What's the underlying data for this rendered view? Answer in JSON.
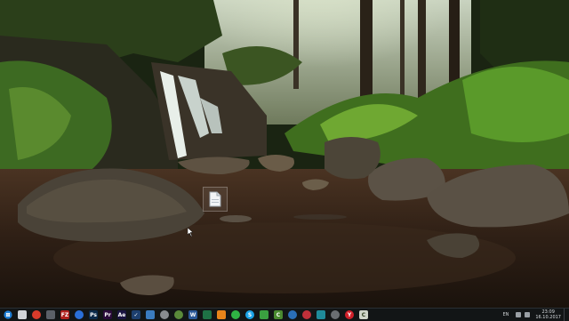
{
  "desktop": {
    "file_icon": "document-icon"
  },
  "taskbar": {
    "start_icon": "windows-icon",
    "pinned": [
      {
        "name": "taskbar-icon-explorer",
        "text": "",
        "bg": "#d0d4d8",
        "round": false
      },
      {
        "name": "taskbar-icon-chrome",
        "text": "",
        "bg": "#d83b2b",
        "round": true
      },
      {
        "name": "taskbar-icon-calculator",
        "text": "",
        "bg": "#5a6068",
        "round": false
      },
      {
        "name": "taskbar-icon-filezilla",
        "text": "FZ",
        "bg": "#b0201c",
        "round": false
      },
      {
        "name": "taskbar-icon-firefox",
        "text": "",
        "bg": "#2a6fd8",
        "round": true
      },
      {
        "name": "taskbar-icon-photoshop",
        "text": "Ps",
        "bg": "#0b2a4a",
        "round": false
      },
      {
        "name": "taskbar-icon-premiere",
        "text": "Pr",
        "bg": "#2a0b3a",
        "round": false
      },
      {
        "name": "taskbar-icon-after-effects",
        "text": "Ae",
        "bg": "#1a1440",
        "round": false
      },
      {
        "name": "taskbar-icon-tasks",
        "text": "✓",
        "bg": "#1d3f6e",
        "round": false
      },
      {
        "name": "taskbar-icon-steam",
        "text": "",
        "bg": "#3a7cc0",
        "round": false
      },
      {
        "name": "taskbar-icon-clock-app",
        "text": "",
        "bg": "#888c90",
        "round": true
      },
      {
        "name": "taskbar-icon-green-app",
        "text": "",
        "bg": "#5a8a3a",
        "round": true
      },
      {
        "name": "taskbar-icon-word",
        "text": "W",
        "bg": "#2b5797",
        "round": false
      },
      {
        "name": "taskbar-icon-excel",
        "text": "",
        "bg": "#1e7145",
        "round": false
      },
      {
        "name": "taskbar-icon-vlc",
        "text": "",
        "bg": "#e8841a",
        "round": false
      },
      {
        "name": "taskbar-icon-whatsapp",
        "text": "",
        "bg": "#2fb344",
        "round": true
      },
      {
        "name": "taskbar-icon-skype",
        "text": "S",
        "bg": "#1aa3e8",
        "round": true
      },
      {
        "name": "taskbar-icon-green-square",
        "text": "",
        "bg": "#3aa040",
        "round": false
      },
      {
        "name": "taskbar-icon-camtasia",
        "text": "C",
        "bg": "#4a8a30",
        "round": false
      },
      {
        "name": "taskbar-icon-search-app",
        "text": "",
        "bg": "#2a6fb8",
        "round": true
      },
      {
        "name": "taskbar-icon-opera",
        "text": "",
        "bg": "#c0303a",
        "round": true
      },
      {
        "name": "taskbar-icon-photos",
        "text": "",
        "bg": "#1f8a9a",
        "round": false
      },
      {
        "name": "taskbar-icon-settings",
        "text": "",
        "bg": "#6a6e72",
        "round": true
      },
      {
        "name": "taskbar-icon-yandex",
        "text": "Y",
        "bg": "#d0202a",
        "round": true
      },
      {
        "name": "taskbar-icon-camtasia-recorder",
        "text": "C",
        "bg": "#cfd4c8",
        "round": false
      }
    ]
  },
  "tray": {
    "language": "EN",
    "time": "23:09",
    "date": "16.10.2017"
  }
}
